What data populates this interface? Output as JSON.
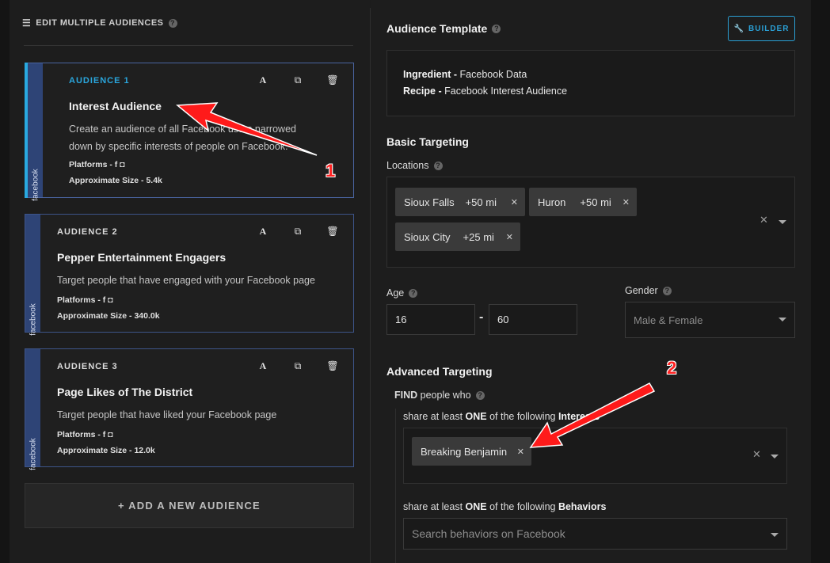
{
  "left": {
    "header": "EDIT MULTIPLE AUDIENCES",
    "cards": [
      {
        "number": "AUDIENCE 1",
        "title": "Interest Audience",
        "description": "Create an audience of all Facebook users narrowed down by specific interests of people on Facebook.",
        "platforms": "Platforms - f ◘",
        "size": "Approximate Size - 5.4k",
        "strip": "facebook"
      },
      {
        "number": "AUDIENCE 2",
        "title": "Pepper Entertainment Engagers",
        "description": "Target people that have engaged with your Facebook page",
        "platforms": "Platforms - f ◘",
        "size": "Approximate Size - 340.0k",
        "strip": "facebook"
      },
      {
        "number": "AUDIENCE 3",
        "title": "Page Likes of The District",
        "description": "Target people that have liked your Facebook page",
        "platforms": "Platforms - f ◘",
        "size": "Approximate Size - 12.0k",
        "strip": "facebook"
      }
    ],
    "add_button": "+ ADD A NEW AUDIENCE"
  },
  "right": {
    "template_title": "Audience Template",
    "builder_label": "BUILDER",
    "ingredient_label": "Ingredient -",
    "ingredient_value": "Facebook Data",
    "recipe_label": "Recipe -",
    "recipe_value": "Facebook Interest Audience",
    "basic_title": "Basic Targeting",
    "locations_label": "Locations",
    "locations": [
      {
        "city": "Sioux Falls",
        "radius": "+50 mi"
      },
      {
        "city": "Huron",
        "radius": "+50 mi"
      },
      {
        "city": "Sioux City",
        "radius": "+25 mi"
      }
    ],
    "age_label": "Age",
    "age_min": "16",
    "age_sep": "-",
    "age_max": "60",
    "gender_label": "Gender",
    "gender_value": "Male & Female",
    "advanced_title": "Advanced Targeting",
    "find_label_bold": "FIND",
    "find_label_rest": " people who",
    "interests_prefix": "share at least ",
    "interests_one": "ONE",
    "interests_mid": " of the following ",
    "interests_word": "Interests",
    "interests": [
      "Breaking Benjamin"
    ],
    "behaviors_prefix": "share at least ",
    "behaviors_one": "ONE",
    "behaviors_mid": " of the following ",
    "behaviors_word": "Behaviors",
    "behaviors_placeholder": "Search behaviors on Facebook"
  },
  "annotations": [
    "1",
    "2"
  ],
  "colors": {
    "accent": "#29a9e0",
    "card_border": "#3d5489",
    "arrow": "#ff2222"
  }
}
